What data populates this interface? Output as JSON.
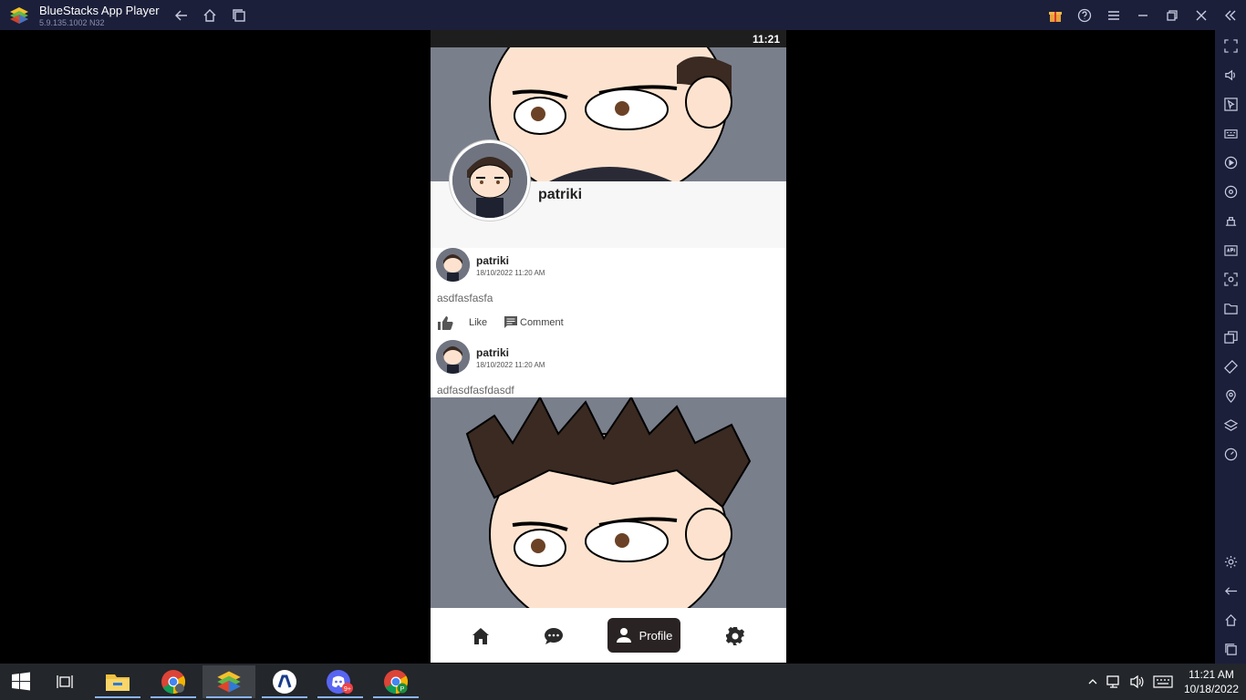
{
  "window": {
    "title": "BlueStacks App Player",
    "version": "5.9.135.1002  N32"
  },
  "status_bar": {
    "time": "11:21"
  },
  "profile": {
    "name": "patriki"
  },
  "posts": [
    {
      "author": "patriki",
      "timestamp": "18/10/2022 11:20 AM",
      "text": "asdfasfasfa",
      "like_label": "Like",
      "comment_label": "Comment"
    },
    {
      "author": "patriki",
      "timestamp": "18/10/2022 11:20 AM",
      "text": "adfasdfasfdasdf"
    }
  ],
  "bottom_nav": {
    "profile_label": "Profile"
  },
  "taskbar": {
    "time": "11:21 AM",
    "date": "10/18/2022",
    "discord_badge": "9+",
    "chrome_profile_badge": "P"
  },
  "colors": {
    "titlebar": "#1b1f3a",
    "active_tab": "#2a2324",
    "cover_bg": "#7a7f8c"
  }
}
